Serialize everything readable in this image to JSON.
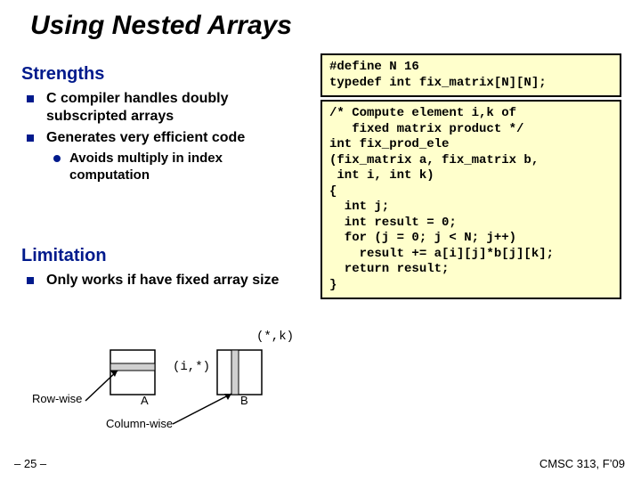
{
  "title": "Using Nested Arrays",
  "sections": {
    "strengths": {
      "heading": "Strengths",
      "items": [
        "C compiler handles doubly subscripted arrays",
        "Generates very efficient code"
      ],
      "subitems": [
        "Avoids multiply in index computation"
      ]
    },
    "limitation": {
      "heading": "Limitation",
      "items": [
        "Only works if have fixed array size"
      ]
    }
  },
  "code1": "#define N 16\ntypedef int fix_matrix[N][N];",
  "code2": "/* Compute element i,k of\n   fixed matrix product */\nint fix_prod_ele\n(fix_matrix a, fix_matrix b,\n int i, int k)\n{\n  int j;\n  int result = 0;\n  for (j = 0; j < N; j++)\n    result += a[i][j]*b[j][k];\n  return result;\n}",
  "diagram": {
    "row_label": "Row-wise",
    "col_label": "Column-wise",
    "matrixA": "A",
    "matrixB": "B",
    "row_coord": "(i,*)",
    "col_coord": "(*,k)"
  },
  "footer": {
    "left": "– 25 –",
    "right": "CMSC 313, F’09"
  }
}
